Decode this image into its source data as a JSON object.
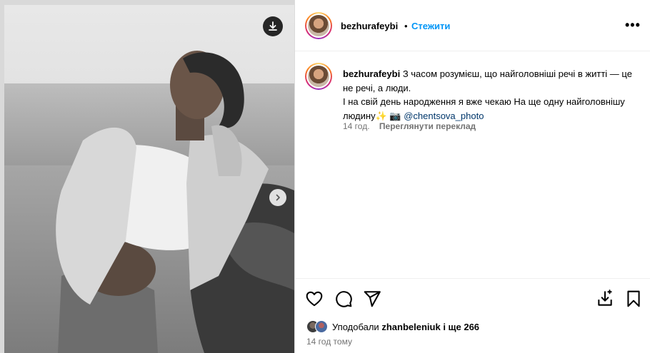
{
  "post": {
    "username": "bezhurafeybi",
    "dot": "•",
    "follow_label": "Стежити",
    "more_label": "•••"
  },
  "caption": {
    "username": "bezhurafeybi",
    "line1": "З часом розумієш, що найголовніші речі в житті — це не речі, а люди.",
    "line2": "І на свій день народження я вже чекаю На ще одну найголовнішу людину",
    "emoji": "✨ 📷",
    "mention": "@chentsova_photo",
    "time": "14 год.",
    "translate_label": "Переглянути переклад"
  },
  "likes": {
    "prefix": "Уподобали",
    "user": "zhanbeleniuk",
    "suffix": "і ще 266"
  },
  "timestamp": "14 год тому",
  "icons": [
    "download-icon",
    "chevron-right-icon",
    "more-icon",
    "heart-icon",
    "comment-icon",
    "share-icon",
    "save-collection-icon",
    "bookmark-icon"
  ],
  "colors": {
    "link": "#0095f6",
    "mention": "#00376b",
    "muted": "#737373"
  }
}
